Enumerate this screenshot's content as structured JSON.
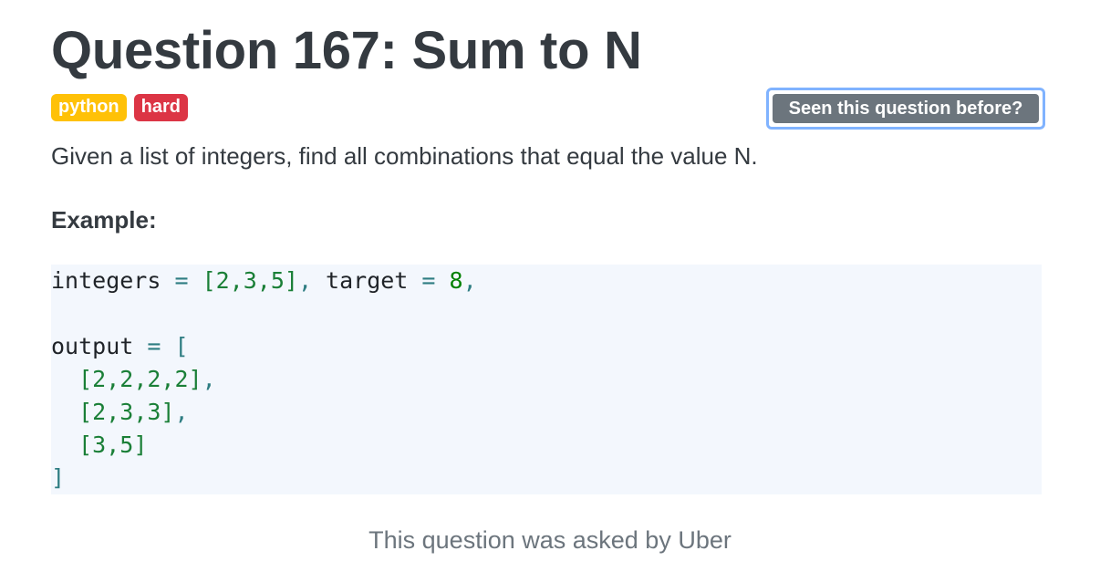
{
  "question": {
    "title": "Question 167: Sum to N",
    "tags": [
      {
        "label": "python",
        "color": "#ffc107"
      },
      {
        "label": "hard",
        "color": "#dc3545"
      }
    ],
    "seen_button_label": "Seen this question before?",
    "description": "Given a list of integers, find all combinations that equal the value N.",
    "example_heading": "Example:",
    "code": {
      "line1": {
        "ident1": "integers",
        "eq1": " = ",
        "list": "[2,3,5]",
        "comma": ", ",
        "ident2": "target",
        "eq2": " = ",
        "num": "8",
        "trail": ","
      },
      "line3": {
        "ident": "output",
        "eq": " = ",
        "open": "["
      },
      "line4": {
        "indent": "  ",
        "list": "[2,2,2,2]",
        "trail": ","
      },
      "line5": {
        "indent": "  ",
        "list": "[2,3,3]",
        "trail": ","
      },
      "line6": {
        "indent": "  ",
        "list": "[3,5]"
      },
      "line7": {
        "close": "]"
      }
    },
    "asked_by": "This question was asked by Uber"
  },
  "colors": {
    "badge_python": "#ffc107",
    "badge_hard": "#dc3545",
    "button_bg": "#6c757d",
    "button_focus_ring": "#80b3ff",
    "code_bg": "#f3f7fd"
  }
}
